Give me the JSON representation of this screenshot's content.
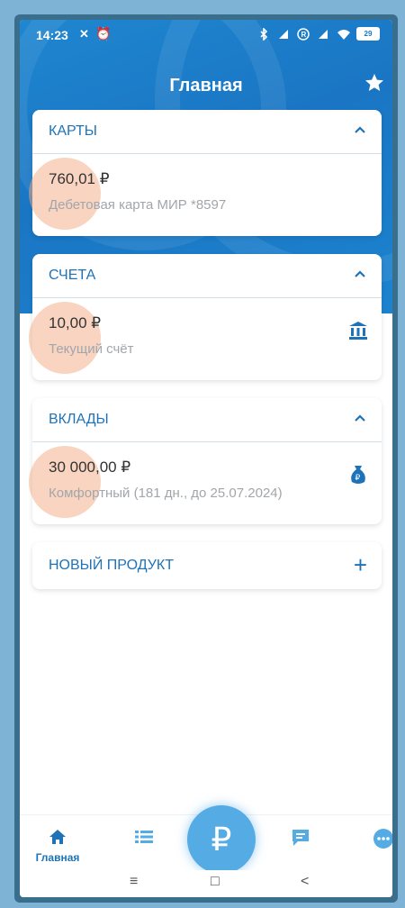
{
  "status_bar": {
    "time": "14:23",
    "battery": "29"
  },
  "header": {
    "title": "Главная"
  },
  "sections": {
    "cards": {
      "title": "КАРТЫ",
      "item": {
        "amount": "760,01 ₽",
        "subtitle": "Дебетовая карта МИР *8597"
      }
    },
    "accounts": {
      "title": "СЧЕТА",
      "item": {
        "amount": "10,00 ₽",
        "subtitle": "Текущий счёт"
      }
    },
    "deposits": {
      "title": "ВКЛАДЫ",
      "item": {
        "amount": "30 000,00 ₽",
        "subtitle": "Комфортный (181 дн., до 25.07.2024)"
      }
    }
  },
  "new_product": {
    "label": "НОВЫЙ ПРОДУКТ",
    "icon": "+"
  },
  "bottom_nav": {
    "home_label": "Главная",
    "fab_symbol": "₽",
    "items": [
      "home-icon",
      "list-icon",
      "ruble-icon",
      "chat-icon",
      "more-icon"
    ]
  },
  "system_nav": {
    "menu": "≡",
    "home": "□",
    "back": "<"
  },
  "colors": {
    "accent": "#1e73b8",
    "header": "#1a76c4",
    "fab": "#55abe4"
  }
}
